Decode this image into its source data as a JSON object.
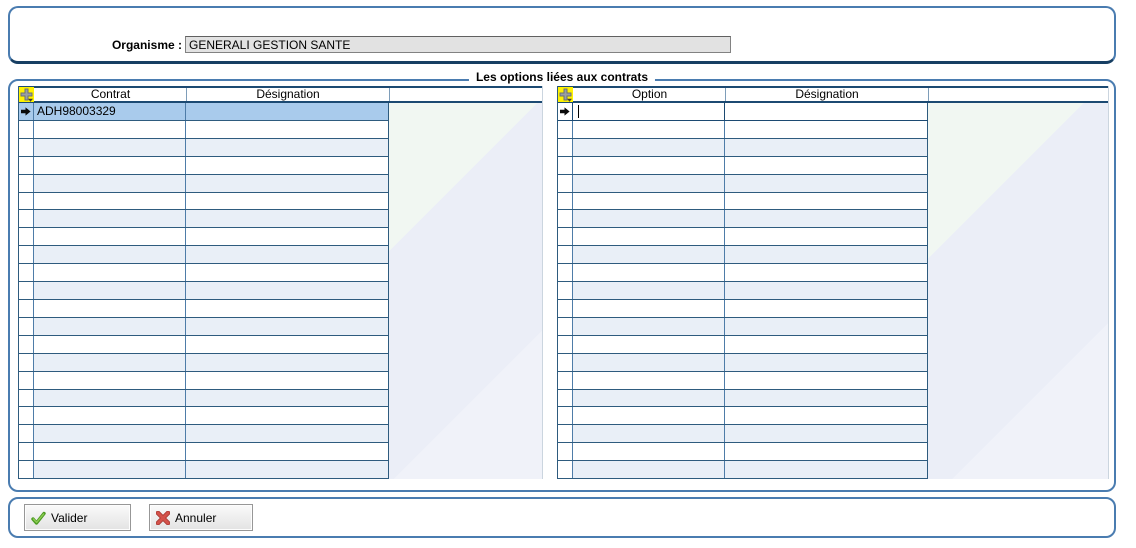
{
  "top_panel": {
    "organisme_label": "Organisme :",
    "organisme_value": "GENERALI GESTION SANTE"
  },
  "group_box": {
    "title": "Les options liées aux contrats"
  },
  "contracts_grid": {
    "columns": [
      "Contrat",
      "Désignation"
    ],
    "rows": [
      [
        "ADH98003329",
        ""
      ]
    ],
    "visible_row_count": 21,
    "selected_row_index": 0,
    "editing_row_index": -1
  },
  "options_grid": {
    "columns": [
      "Option",
      "Désignation"
    ],
    "rows": [
      [
        "",
        ""
      ]
    ],
    "visible_row_count": 21,
    "selected_row_index": -1,
    "editing_row_index": 0
  },
  "footer": {
    "valider_label": "Valider",
    "annuler_label": "Annuler"
  },
  "colors": {
    "selected_row": "#A9CBEC",
    "alt_row": "#E9EFF7",
    "row_bg": "#FFFFFF",
    "grid_line": "#2E5B7E",
    "header_line": "#1C4A72",
    "panel_border": "#4A7CB0",
    "add_icon_bg": "#FFF200",
    "valider_icon_green": "#56A228",
    "annuler_icon_red": "#D4524A"
  }
}
